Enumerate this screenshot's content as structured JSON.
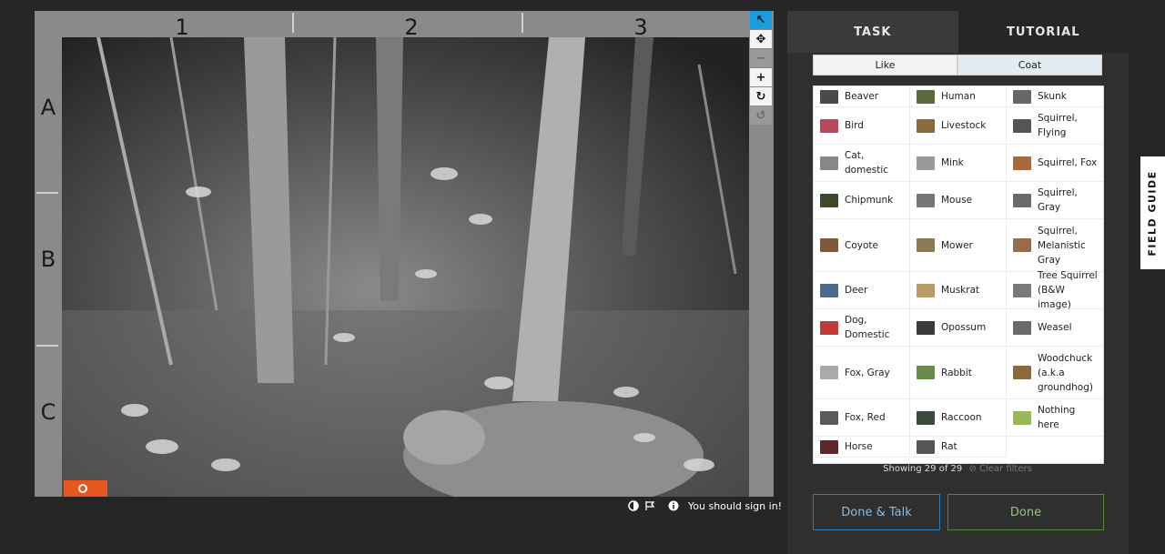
{
  "viewer": {
    "columns": [
      "1",
      "2",
      "3"
    ],
    "rows": [
      "A",
      "B",
      "C"
    ],
    "tools": [
      {
        "name": "pointer-tool-button",
        "icon": "pointer-icon",
        "glyph": "↖",
        "state": "active"
      },
      {
        "name": "move-tool-button",
        "icon": "move-icon",
        "glyph": "✥",
        "state": "normal"
      },
      {
        "name": "zoom-out-button",
        "icon": "minus-icon",
        "glyph": "−",
        "state": "disabled"
      },
      {
        "name": "zoom-in-button",
        "icon": "plus-icon",
        "glyph": "+",
        "state": "normal"
      },
      {
        "name": "rotate-button",
        "icon": "rotate-icon",
        "glyph": "↻",
        "state": "normal"
      },
      {
        "name": "reset-button",
        "icon": "reset-icon",
        "glyph": "↺",
        "state": "disabled"
      }
    ],
    "sign_in": "You should sign in!"
  },
  "panel": {
    "tabs": [
      "TASK",
      "TUTORIAL"
    ],
    "filters": [
      "Like",
      "Coat"
    ],
    "species": [
      {
        "label": "Beaver",
        "color": "#4a4a4a"
      },
      {
        "label": "Human",
        "color": "#5a6a3a"
      },
      {
        "label": "Skunk",
        "color": "#666666"
      },
      {
        "label": "Bird",
        "color": "#b84a5a"
      },
      {
        "label": "Livestock",
        "color": "#8a6a3a"
      },
      {
        "label": "Squirrel, Flying",
        "color": "#555555"
      },
      {
        "label": "Cat, domestic",
        "color": "#888888"
      },
      {
        "label": "Mink",
        "color": "#999999"
      },
      {
        "label": "Squirrel, Fox",
        "color": "#a86a3a"
      },
      {
        "label": "Chipmunk",
        "color": "#3a4a2a"
      },
      {
        "label": "Mouse",
        "color": "#777777"
      },
      {
        "label": "Squirrel, Gray",
        "color": "#6a6a6a"
      },
      {
        "label": "Coyote",
        "color": "#7a5a3a"
      },
      {
        "label": "Mower",
        "color": "#8a7a5a"
      },
      {
        "label": "Squirrel, Melanistic Gray",
        "color": "#9a6a4a"
      },
      {
        "label": "Deer",
        "color": "#4a6a8a"
      },
      {
        "label": "Muskrat",
        "color": "#b89a6a"
      },
      {
        "label": "Tree Squirrel (B&W image)",
        "color": "#7a7a7a"
      },
      {
        "label": "Dog, Domestic",
        "color": "#c03a3a"
      },
      {
        "label": "Opossum",
        "color": "#3a3a3a"
      },
      {
        "label": "Weasel",
        "color": "#6a6a6a"
      },
      {
        "label": "Fox, Gray",
        "color": "#aaaaaa"
      },
      {
        "label": "Rabbit",
        "color": "#6a8a4a"
      },
      {
        "label": "Woodchuck (a.k.a groundhog)",
        "color": "#8a6a3a"
      },
      {
        "label": "Fox, Red",
        "color": "#5a5a5a"
      },
      {
        "label": "Raccoon",
        "color": "#3a4a3a"
      },
      {
        "label": "Nothing here",
        "color": "#9ab85a"
      },
      {
        "label": "Horse",
        "color": "#5a2a2a"
      },
      {
        "label": "Rat",
        "color": "#555555"
      }
    ],
    "showing": "Showing 29 of 29",
    "clear_filters": "Clear filters",
    "done_talk": "Done & Talk",
    "done": "Done"
  },
  "field_guide": "FIELD GUIDE",
  "colors": {
    "accent_blue": "#1a9de0",
    "done_talk_border": "#2a7bbf",
    "done_border": "#4f8a37",
    "badge_orange": "#e8561f"
  }
}
